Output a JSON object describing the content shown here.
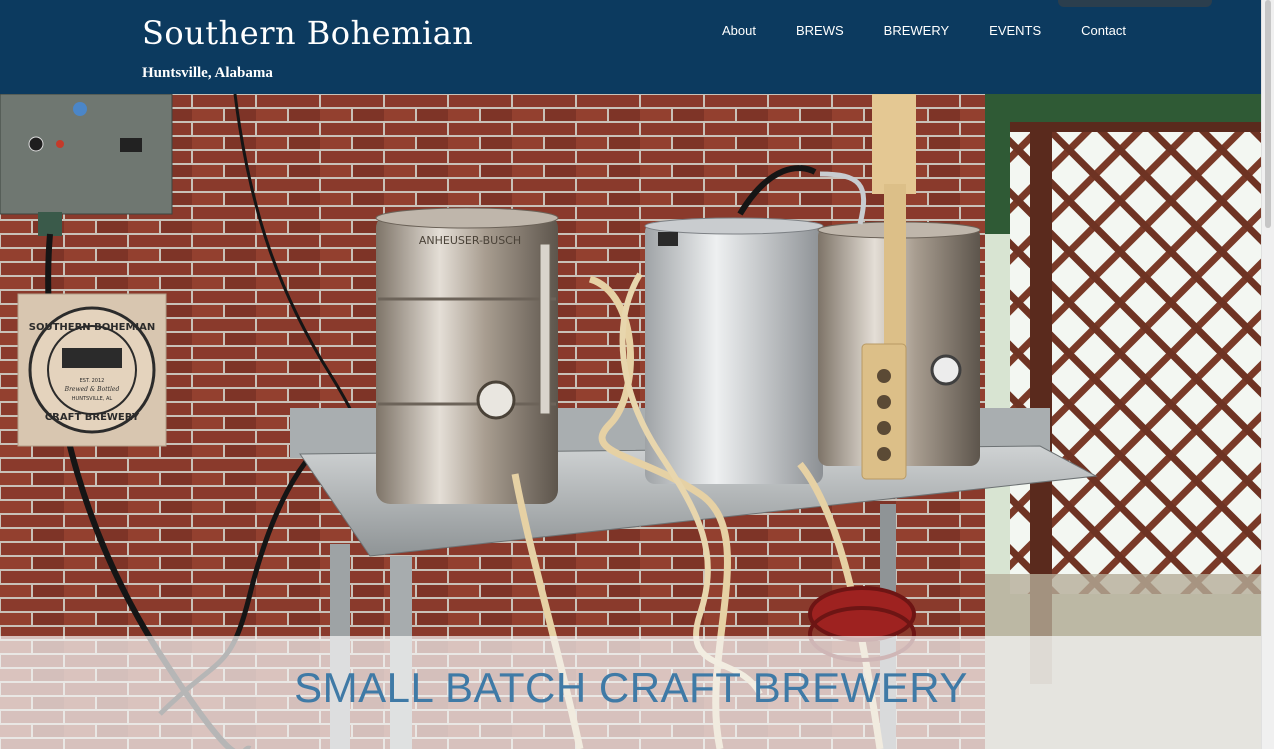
{
  "site": {
    "title": "Southern Bohemian",
    "subtitle": "Huntsville, Alabama"
  },
  "nav": {
    "items": [
      {
        "label": "About"
      },
      {
        "label": "BREWS"
      },
      {
        "label": "BREWERY"
      },
      {
        "label": "EVENTS"
      },
      {
        "label": "Contact"
      }
    ]
  },
  "hero": {
    "headline": "SMALL BATCH CRAFT BREWERY",
    "sign_lines": [
      "SOUTHERN BOHEMIAN",
      "CRAFT BREWERY",
      "EST. 2012",
      "Brewed & Bottled",
      "HUNTSVILLE, AL"
    ],
    "keg_text": "ANHEUSER-BUSCH"
  },
  "colors": {
    "header_bg": "#0c3a5f",
    "headline": "#3f7aa6",
    "band": "#f5f5f5"
  }
}
